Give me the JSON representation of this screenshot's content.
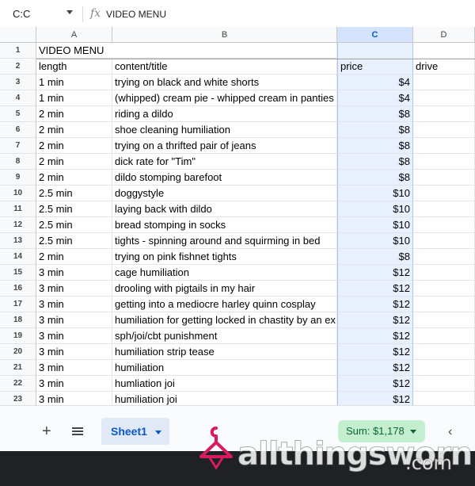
{
  "formula_bar": {
    "name_box": "C:C",
    "fx_icon": "fx-icon",
    "value": "VIDEO MENU"
  },
  "columns": [
    "A",
    "B",
    "C",
    "D"
  ],
  "title_row": {
    "row": "1",
    "text": "VIDEO MENU"
  },
  "header_row": {
    "row": "2",
    "length": "length",
    "content": "content/title",
    "price": "price",
    "drive": "drive"
  },
  "rows": [
    {
      "num": "3",
      "length": "1 min",
      "content": "trying on black and white shorts",
      "price": "$4"
    },
    {
      "num": "4",
      "length": "1 min",
      "content": "(whipped) cream pie - whipped cream in panties",
      "price": "$4"
    },
    {
      "num": "5",
      "length": "2 min",
      "content": "riding a dildo",
      "price": "$8"
    },
    {
      "num": "6",
      "length": "2 min",
      "content": "shoe cleaning humiliation",
      "price": "$8"
    },
    {
      "num": "7",
      "length": "2 min",
      "content": "trying on a thrifted pair of jeans",
      "price": "$8"
    },
    {
      "num": "8",
      "length": "2 min",
      "content": "dick rate for \"Tim\"",
      "price": "$8"
    },
    {
      "num": "9",
      "length": "2 min",
      "content": "dildo stomping barefoot",
      "price": "$8"
    },
    {
      "num": "10",
      "length": "2.5 min",
      "content": "doggystyle",
      "price": "$10"
    },
    {
      "num": "11",
      "length": "2.5 min",
      "content": "laying back with dildo",
      "price": "$10"
    },
    {
      "num": "12",
      "length": "2.5 min",
      "content": "bread stomping in socks",
      "price": "$10"
    },
    {
      "num": "13",
      "length": "2.5 min",
      "content": "tights - spinning around and squirming in bed",
      "price": "$10"
    },
    {
      "num": "14",
      "length": "2 min",
      "content": "trying on pink fishnet tights",
      "price": "$8"
    },
    {
      "num": "15",
      "length": "3 min",
      "content": "cage humiliation",
      "price": "$12"
    },
    {
      "num": "16",
      "length": "3 min",
      "content": "drooling with pigtails in my hair",
      "price": "$12"
    },
    {
      "num": "17",
      "length": "3 min",
      "content": "getting into a mediocre harley quinn cosplay",
      "price": "$12"
    },
    {
      "num": "18",
      "length": "3 min",
      "content": "humiliation for getting locked in chastity by an ex",
      "price": "$12"
    },
    {
      "num": "19",
      "length": "3 min",
      "content": "sph/joi/cbt punishment",
      "price": "$12"
    },
    {
      "num": "20",
      "length": "3 min",
      "content": "humiliation strip tease",
      "price": "$12"
    },
    {
      "num": "21",
      "length": "3 min",
      "content": "humiliation",
      "price": "$12"
    },
    {
      "num": "22",
      "length": "3 min",
      "content": "humliation joi",
      "price": "$12"
    },
    {
      "num": "23",
      "length": "3 min",
      "content": "humiliation joi",
      "price": "$12"
    }
  ],
  "bottom_bar": {
    "add_sheet": "+",
    "sheet_tab": "Sheet1",
    "sum": "Sum: $1,178",
    "chevron": "‹"
  },
  "watermark": {
    "text": "allthingsworn",
    "tld": ".com"
  },
  "colors": {
    "selected_column": "#e8f0fe",
    "sheet_tab_text": "#0b57d0",
    "sum_pill": "#c4eed0"
  }
}
